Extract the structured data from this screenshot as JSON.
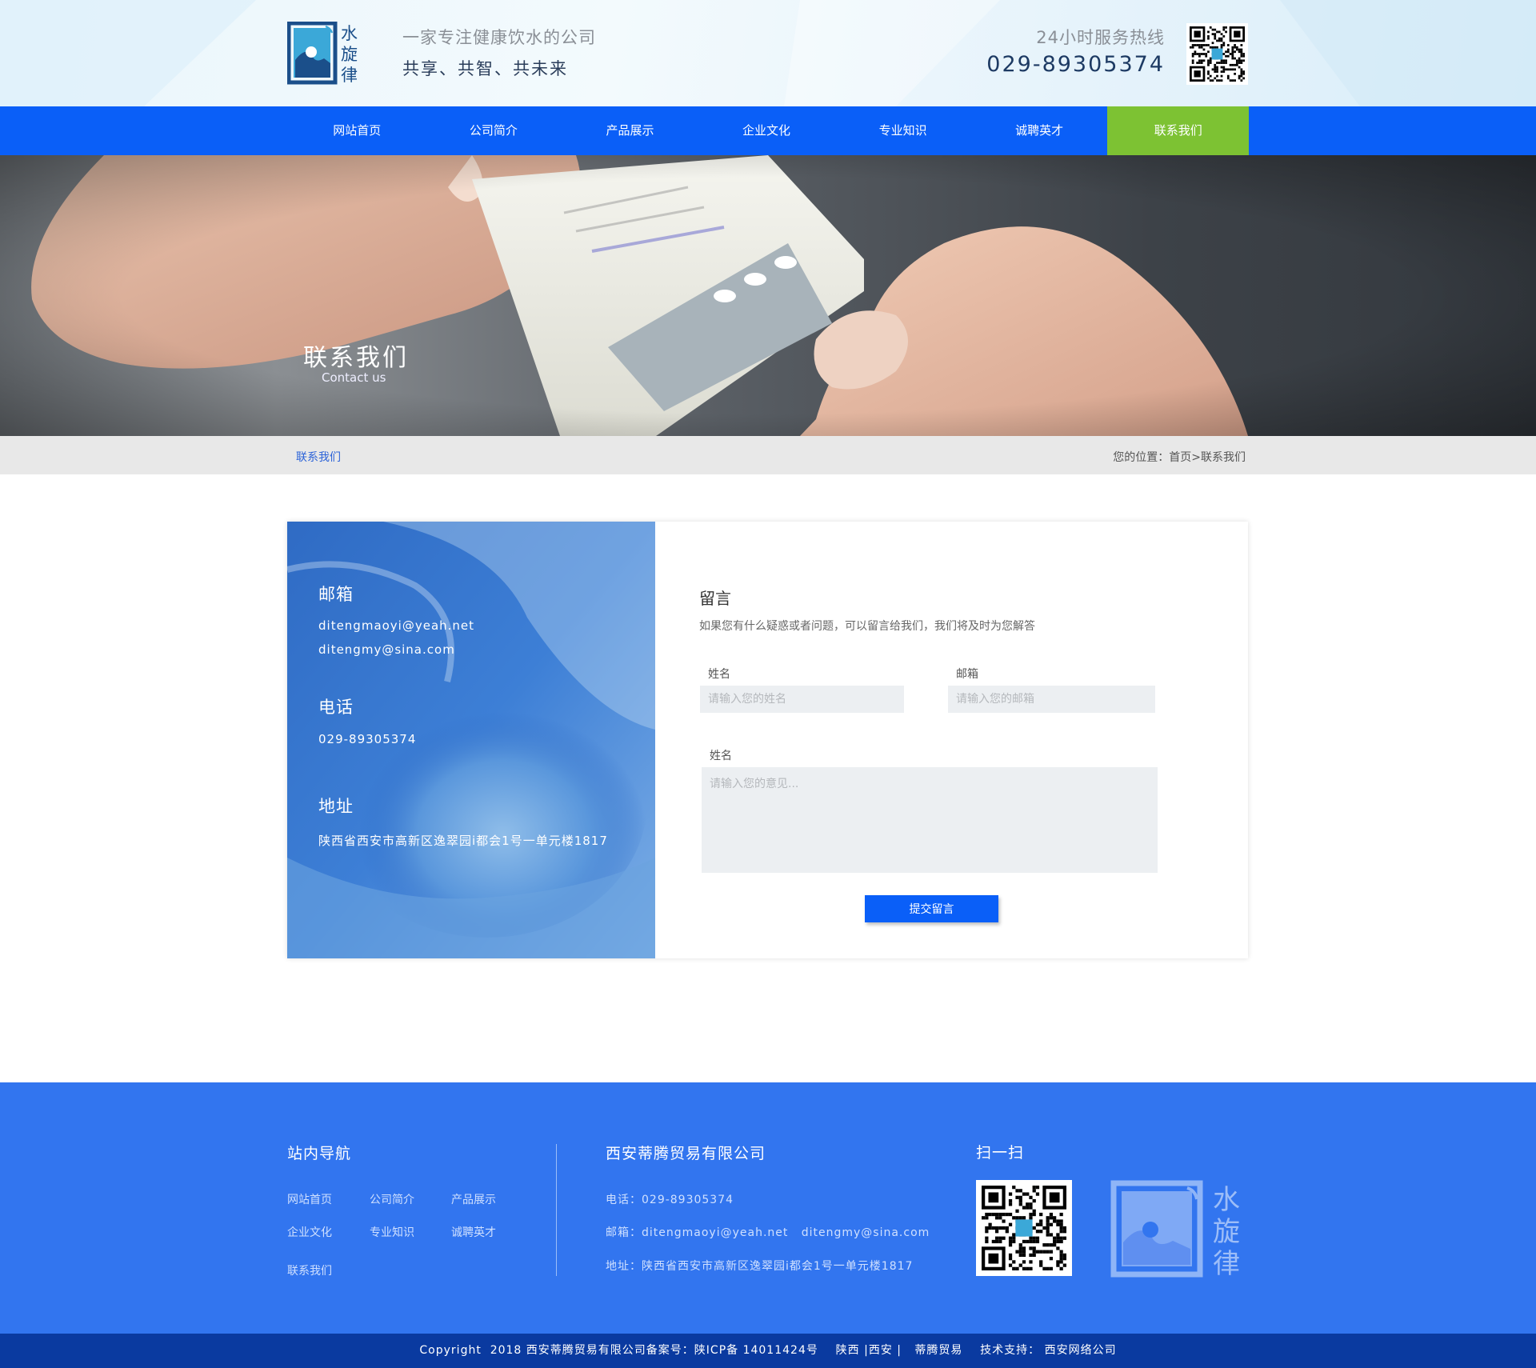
{
  "header": {
    "logo_text": "水旋律",
    "slogan_line1": "一家专注健康饮水的公司",
    "slogan_line2": "共享、共智、共未来",
    "hotline_label": "24小时服务热线",
    "hotline_number": "029-89305374"
  },
  "nav": {
    "items": [
      {
        "label": "网站首页"
      },
      {
        "label": "公司简介"
      },
      {
        "label": "产品展示"
      },
      {
        "label": "企业文化"
      },
      {
        "label": "专业知识"
      },
      {
        "label": "诚聘英才"
      },
      {
        "label": "联系我们",
        "active": true
      }
    ]
  },
  "banner": {
    "title": "联系我们",
    "subtitle": "Contact us"
  },
  "breadcrumb": {
    "section": "联系我们",
    "prefix": "您的位置：",
    "home": "首页",
    "separator": ">",
    "current": "联系我们"
  },
  "contact": {
    "email_heading": "邮箱",
    "email1": "ditengmaoyi@yeah.net",
    "email2": "ditengmy@sina.com",
    "phone_heading": "电话",
    "phone": "029-89305374",
    "address_heading": "地址",
    "address": "陕西省西安市高新区逸翠园i都会1号一单元楼1817"
  },
  "form": {
    "title": "留言",
    "description": "如果您有什么疑惑或者问题，可以留言给我们，我们将及时为您解答",
    "name_label": "姓名",
    "name_placeholder": "请输入您的姓名",
    "email_label": "邮箱",
    "email_placeholder": "请输入您的邮箱",
    "message_label": "姓名",
    "message_placeholder": "请输入您的意见...",
    "submit_label": "提交留言"
  },
  "footer": {
    "nav_heading": "站内导航",
    "nav_links": [
      "网站首页",
      "公司简介",
      "产品展示",
      "企业文化",
      "专业知识",
      "诚聘英才",
      "联系我们"
    ],
    "company_name": "西安蒂腾贸易有限公司",
    "phone_line": "电话：029-89305374",
    "email_line": "邮箱：ditengmaoyi@yeah.net   ditengmy@sina.com",
    "address_line": "地址：陕西省西安市高新区逸翠园i都会1号一单元楼1817",
    "scan_heading": "扫一扫",
    "logo_text": "水旋律"
  },
  "copyright": "Copyright  2018 西安蒂腾贸易有限公司备案号：陕ICP备 14011424号    陕西 |西安 |   蒂腾贸易    技术支持： 西安网络公司",
  "colors": {
    "nav_blue": "#0a5ff8",
    "nav_active_green": "#7dc233",
    "footer_blue": "#3275ef",
    "copyright_blue": "#0a3aa0"
  }
}
